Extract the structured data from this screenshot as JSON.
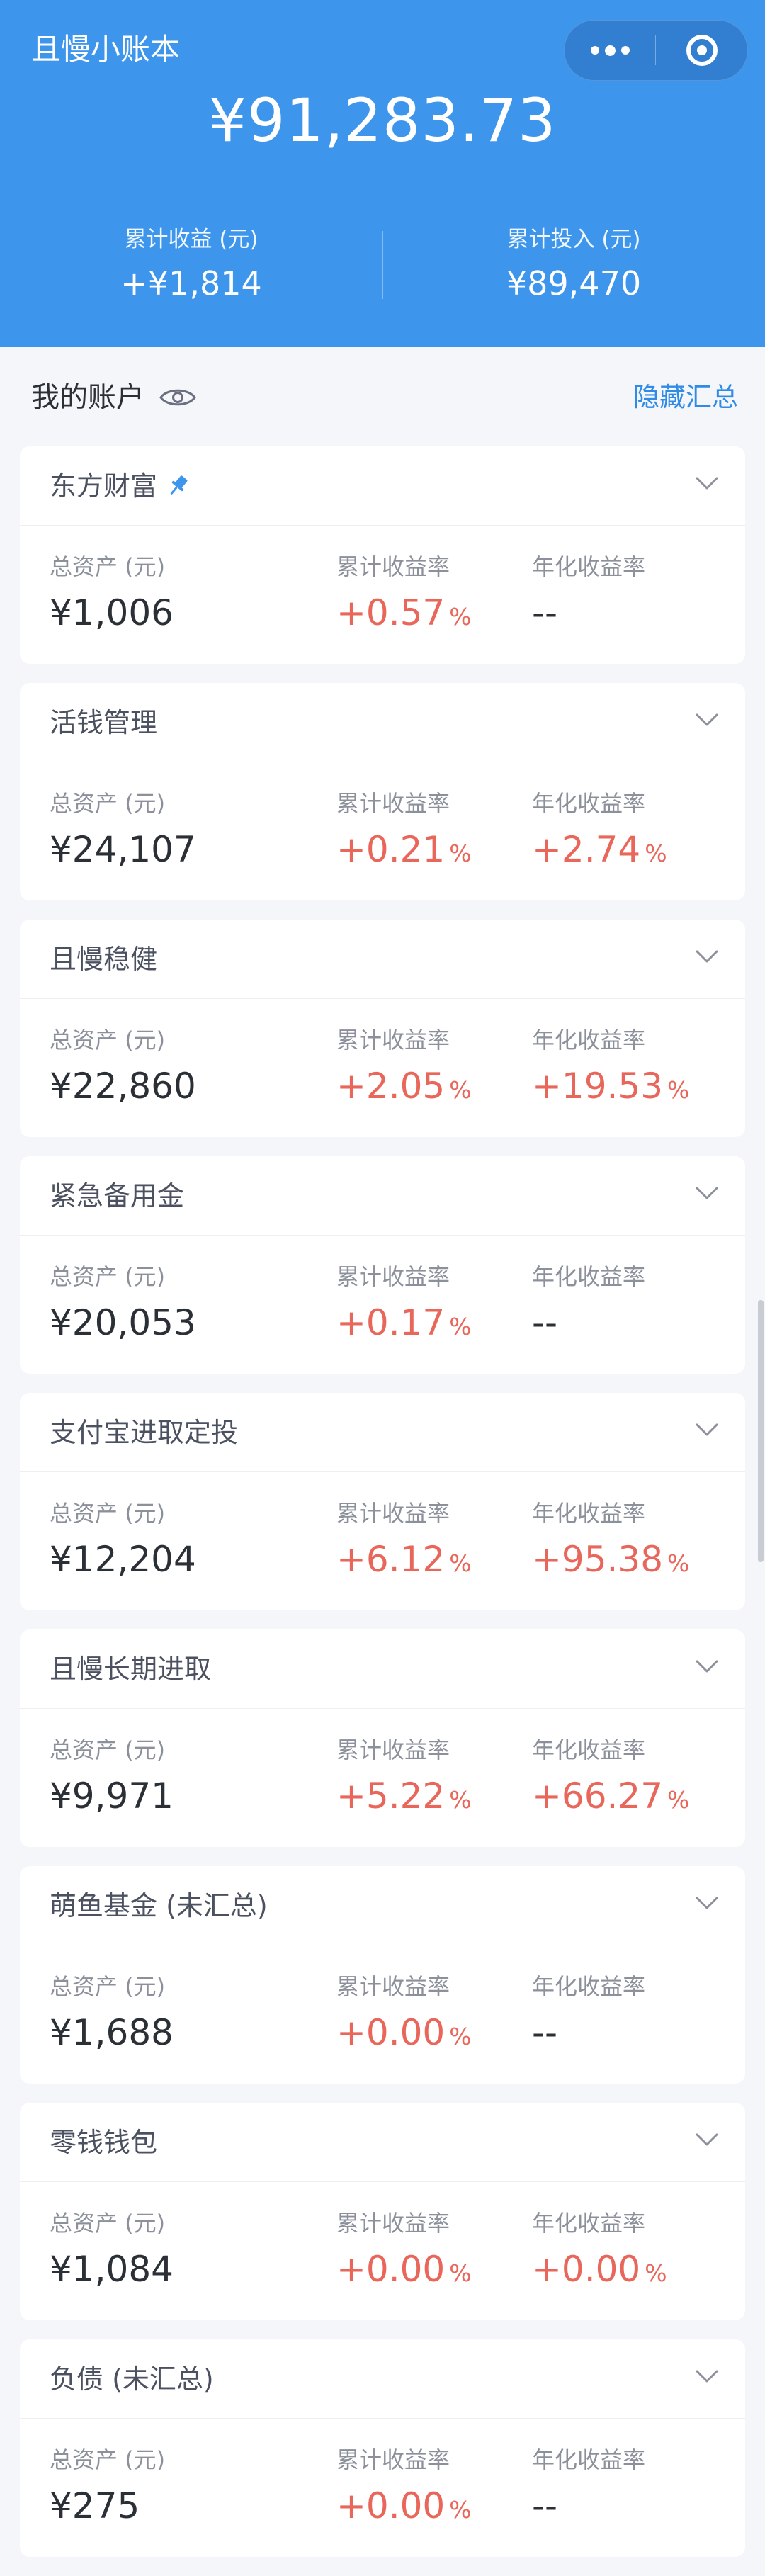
{
  "app": {
    "title": "且慢小账本"
  },
  "capsule": {
    "more_icon": "more-dots-icon",
    "close_icon": "target-circle-icon"
  },
  "overview": {
    "total": "¥91,283.73",
    "cum_income_label": "累计收益 (元)",
    "cum_income_value": "+¥1,814",
    "cum_invest_label": "累计投入 (元)",
    "cum_invest_value": "¥89,470"
  },
  "accounts": {
    "title": "我的账户",
    "eye_icon": "eye-icon",
    "hide_summary_label": "隐藏汇总",
    "labels": {
      "asset": "总资产 (元)",
      "cum_rate": "累计收益率",
      "annual_rate": "年化收益率",
      "pct": "%"
    },
    "items": [
      {
        "name": "东方财富",
        "asset": "¥1,006",
        "cum_rate": "+0.57",
        "annual_rate": "--"
      },
      {
        "name": "活钱管理",
        "asset": "¥24,107",
        "cum_rate": "+0.21",
        "annual_rate": "+2.74"
      },
      {
        "name": "且慢稳健",
        "asset": "¥22,860",
        "cum_rate": "+2.05",
        "annual_rate": "+19.53"
      },
      {
        "name": "紧急备用金",
        "asset": "¥20,053",
        "cum_rate": "+0.17",
        "annual_rate": "--"
      },
      {
        "name": "支付宝进取定投",
        "asset": "¥12,204",
        "cum_rate": "+6.12",
        "annual_rate": "+95.38"
      },
      {
        "name": "且慢长期进取",
        "asset": "¥9,971",
        "cum_rate": "+5.22",
        "annual_rate": "+66.27"
      },
      {
        "name": "萌鱼基金 (未汇总)",
        "asset": "¥1,688",
        "cum_rate": "+0.00",
        "annual_rate": "--"
      },
      {
        "name": "零钱钱包",
        "asset": "¥1,084",
        "cum_rate": "+0.00",
        "annual_rate": "+0.00"
      },
      {
        "name": "负债 (未汇总)",
        "asset": "¥275",
        "cum_rate": "+0.00",
        "annual_rate": "--"
      }
    ]
  },
  "colors": {
    "header_bg": "#3d95ec",
    "positive": "#e9665a",
    "link": "#2f8be6",
    "pin": "#3d95ec"
  }
}
